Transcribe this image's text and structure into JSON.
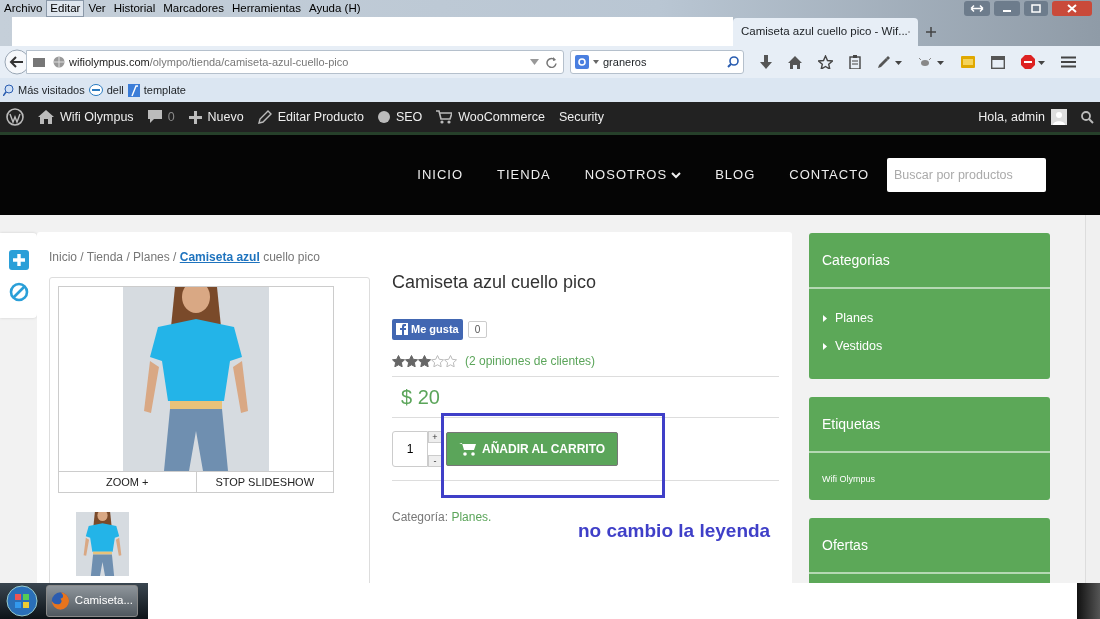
{
  "menu_bar": {
    "items": [
      {
        "label": "Archivo",
        "selected": false
      },
      {
        "label": "Editar",
        "selected": true
      },
      {
        "label": "Ver",
        "selected": false
      },
      {
        "label": "Historial",
        "selected": false
      },
      {
        "label": "Marcadores",
        "selected": false
      },
      {
        "label": "Herramientas",
        "selected": false
      },
      {
        "label": "Ayuda (H)",
        "selected": false
      }
    ]
  },
  "tabs": [
    {
      "title": "Camiseta azul cuello pico - Wif...",
      "selected": true
    }
  ],
  "address_bar": {
    "domain": "wifiolympus.com",
    "path": "/olympo/tienda/camiseta-azul-cuello-pico"
  },
  "search_box": {
    "value": "graneros"
  },
  "bookmarks": [
    {
      "label": "Más visitados",
      "kind": "search"
    },
    {
      "label": "dell",
      "kind": "dell"
    },
    {
      "label": "template",
      "kind": "f"
    }
  ],
  "admin_bar": {
    "items": [
      {
        "label": "Wifi Olympus",
        "kind": "home"
      },
      {
        "label": "0",
        "kind": "comments"
      },
      {
        "label": "Nuevo",
        "kind": "new"
      },
      {
        "label": "Editar Producto",
        "kind": "edit"
      },
      {
        "label": "SEO",
        "kind": "seo"
      },
      {
        "label": "WooCommerce",
        "kind": "cart"
      },
      {
        "label": "Security",
        "kind": "text"
      }
    ],
    "greeting": "Hola, admin"
  },
  "site_nav": {
    "items": [
      {
        "label": "INICIO",
        "has_submenu": false
      },
      {
        "label": "TIENDA",
        "has_submenu": false
      },
      {
        "label": "NOSOTROS",
        "has_submenu": true
      },
      {
        "label": "BLOG",
        "has_submenu": false
      },
      {
        "label": "CONTACTO",
        "has_submenu": false
      }
    ],
    "search_placeholder": "Buscar por productos"
  },
  "breadcrumb": {
    "items": [
      "Inicio",
      "Tienda",
      "Planes"
    ],
    "separator": "/",
    "current_link": "Camiseta azul",
    "current_rest": "cuello pico"
  },
  "gallery": {
    "zoom": "ZOOM +",
    "slideshow": "STOP SLIDESHOW"
  },
  "product": {
    "title": "Camiseta azul cuello pico",
    "like_label": "Me gusta",
    "like_count": "0",
    "stars": 3,
    "reviews": "(2 opiniones de clientes)",
    "price": "$ 20",
    "quantity": "1",
    "qty_plus": "+",
    "qty_minus": "-",
    "add_to_cart": "AÑADIR AL CARRITO",
    "category_label": "Categoría:",
    "category_link": "Planes."
  },
  "annotation": {
    "text": "no cambio la leyenda"
  },
  "sidebar": [
    {
      "title": "Categorias",
      "kind": "list",
      "items": [
        "Planes",
        "Vestidos"
      ]
    },
    {
      "title": "Etiquetas",
      "kind": "tags",
      "items": [
        "Wifi Olympus"
      ]
    },
    {
      "title": "Ofertas",
      "kind": "products"
    }
  ],
  "taskbar": {
    "window_button": "Camiseta..."
  }
}
